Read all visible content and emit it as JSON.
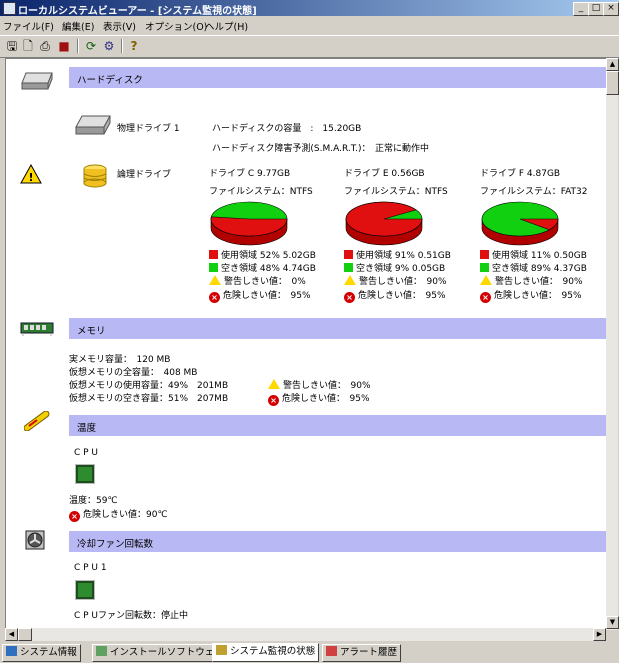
{
  "window": {
    "title": "ローカルシステムビューアー - [システム監視の状態]",
    "min": "_",
    "max": "□",
    "close": "×"
  },
  "menu": [
    "ファイル(F)",
    "編集(E)",
    "表示(V)",
    "オプション(O)",
    "ヘルプ(H)"
  ],
  "toolbar": {
    "icons": [
      "save-icon",
      "print-preview-icon",
      "print-icon",
      "stop-icon",
      "refresh-icon",
      "settings-icon",
      "help-icon"
    ]
  },
  "harddisk": {
    "header": "ハードディスク",
    "physical_label": "物理ドライブ 1",
    "capacity_label": "ハードディスクの容量　:　15.20GB",
    "smart_label": "ハードディスク障害予測(S.M.A.R.T.)：　正常に動作中",
    "logical_label": "論理ドライブ",
    "drives": [
      {
        "title": "ドライブ C 9.77GB",
        "fs": "ファイルシステム：NTFS",
        "used_pct": 52,
        "used": "使用領域 52% 5.02GB",
        "free": "空き領域 48% 4.74GB",
        "warn": "警告しきい値：　0%",
        "danger": "危険しきい値：　95%"
      },
      {
        "title": "ドライブ E 0.56GB",
        "fs": "ファイルシステム：NTFS",
        "used_pct": 91,
        "used": "使用領域 91% 0.51GB",
        "free": "空き領域 9% 0.05GB",
        "warn": "警告しきい値：　90%",
        "danger": "危険しきい値：　95%"
      },
      {
        "title": "ドライブ F 4.87GB",
        "fs": "ファイルシステム：FAT32",
        "used_pct": 11,
        "used": "使用領域 11% 0.50GB",
        "free": "空き領域 89% 4.37GB",
        "warn": "警告しきい値：　90%",
        "danger": "危険しきい値：　95%"
      }
    ]
  },
  "memory": {
    "header": "メモリ",
    "lines": [
      "実メモリ容量：　120 MB",
      "仮想メモリの全容量：　408 MB",
      "仮想メモリの使用容量：49%　201MB",
      "仮想メモリの空き容量：51%　207MB"
    ],
    "warn": "警告しきい値：　90%",
    "danger": "危険しきい値：　95%"
  },
  "temperature": {
    "header": "温度",
    "cpu_label": "C P U",
    "value": "温度：59℃",
    "danger": "危険しきい値：90℃"
  },
  "fan": {
    "header": "冷却ファン回転数",
    "cpu_label": "C P U 1",
    "value": "C P Uファン回転数：停止中"
  },
  "tabs": [
    "システム情報",
    "インストールソフトウェア",
    "システム監視の状態",
    "アラート履歴"
  ],
  "colors": {
    "used": "#e01010",
    "free": "#10d010",
    "section": "#b8b8f4",
    "titlebar": "#0a246a"
  }
}
